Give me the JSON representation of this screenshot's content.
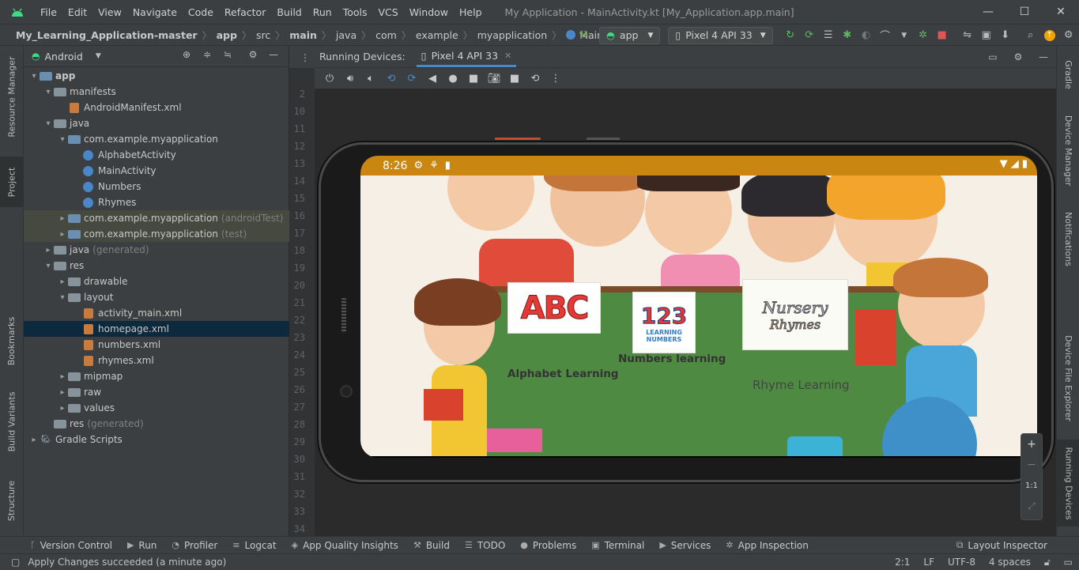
{
  "menubar": {
    "items": [
      "File",
      "Edit",
      "View",
      "Navigate",
      "Code",
      "Refactor",
      "Build",
      "Run",
      "Tools",
      "VCS",
      "Window",
      "Help"
    ],
    "window_title": "My Application - MainActivity.kt [My_Application.app.main]"
  },
  "breadcrumb": [
    "My_Learning_Application-master",
    "app",
    "src",
    "main",
    "java",
    "com",
    "example",
    "myapplication",
    "MainActivity"
  ],
  "toolbar": {
    "run_config": "app",
    "device": "Pixel 4 API 33"
  },
  "left_strip": {
    "tabs": [
      "Resource Manager",
      "Project",
      "Bookmarks",
      "Build Variants",
      "Structure"
    ]
  },
  "project_panel": {
    "view_mode": "Android",
    "tree": [
      {
        "label": "app",
        "depth": 0,
        "expanded": true,
        "icon": "module",
        "bold": true
      },
      {
        "label": "manifests",
        "depth": 1,
        "expanded": true,
        "icon": "folder"
      },
      {
        "label": "AndroidManifest.xml",
        "depth": 2,
        "icon": "manifest"
      },
      {
        "label": "java",
        "depth": 1,
        "expanded": true,
        "icon": "folder"
      },
      {
        "label": "com.example.myapplication",
        "depth": 2,
        "expanded": true,
        "icon": "package"
      },
      {
        "label": "AlphabetActivity",
        "depth": 3,
        "icon": "kotlin"
      },
      {
        "label": "MainActivity",
        "depth": 3,
        "icon": "kotlin"
      },
      {
        "label": "Numbers",
        "depth": 3,
        "icon": "kotlin"
      },
      {
        "label": "Rhymes",
        "depth": 3,
        "icon": "kotlin"
      },
      {
        "label": "com.example.myapplication",
        "suffix": "(androidTest)",
        "depth": 2,
        "collapsed": true,
        "icon": "package",
        "tinted": true
      },
      {
        "label": "com.example.myapplication",
        "suffix": "(test)",
        "depth": 2,
        "collapsed": true,
        "icon": "package",
        "tinted": true
      },
      {
        "label": "java",
        "suffix": "(generated)",
        "depth": 1,
        "collapsed": true,
        "icon": "folder"
      },
      {
        "label": "res",
        "depth": 1,
        "expanded": true,
        "icon": "folder"
      },
      {
        "label": "drawable",
        "depth": 2,
        "collapsed": true,
        "icon": "folder"
      },
      {
        "label": "layout",
        "depth": 2,
        "expanded": true,
        "icon": "folder"
      },
      {
        "label": "activity_main.xml",
        "depth": 3,
        "icon": "xml"
      },
      {
        "label": "homepage.xml",
        "depth": 3,
        "icon": "xml",
        "selected": true
      },
      {
        "label": "numbers.xml",
        "depth": 3,
        "icon": "xml"
      },
      {
        "label": "rhymes.xml",
        "depth": 3,
        "icon": "xml"
      },
      {
        "label": "mipmap",
        "depth": 2,
        "collapsed": true,
        "icon": "folder"
      },
      {
        "label": "raw",
        "depth": 2,
        "collapsed": true,
        "icon": "folder"
      },
      {
        "label": "values",
        "depth": 2,
        "collapsed": true,
        "icon": "folder"
      },
      {
        "label": "res",
        "suffix": "(generated)",
        "depth": 1,
        "icon": "folder"
      },
      {
        "label": "Gradle Scripts",
        "depth": 0,
        "collapsed": true,
        "icon": "gradle"
      }
    ]
  },
  "gutter": {
    "line_numbers": [
      "2",
      "10",
      "11",
      "12",
      "13",
      "14",
      "15",
      "16",
      "17",
      "18",
      "19",
      "20",
      "21",
      "22",
      "23",
      "24",
      "25",
      "26",
      "27",
      "28",
      "29",
      "30",
      "31",
      "32",
      "33",
      "34"
    ]
  },
  "running_devices": {
    "title": "Running Devices:",
    "tab": "Pixel 4 API 33"
  },
  "device_screen": {
    "status_time": "8:26",
    "cards": [
      {
        "name": "Alphabet Learning",
        "label": "Alphabet Learning",
        "image_text": "ABC"
      },
      {
        "name": "Numbers learning",
        "label": "Numbers learning",
        "image_text_top": "123",
        "image_text_bottom": "LEARNING NUMBERS"
      },
      {
        "name": "Rhyme Learning",
        "label": "Rhyme Learning",
        "image_text_top": "Nursery",
        "image_text_bottom": "Rhymes"
      }
    ]
  },
  "zoom": {
    "plus": "+",
    "minus": "−",
    "one_to_one": "1:1"
  },
  "right_strip": {
    "tabs": [
      "Gradle",
      "Device Manager",
      "Notifications",
      "Device File Explorer",
      "Running Devices"
    ]
  },
  "bottom_tools": [
    "Version Control",
    "Run",
    "Profiler",
    "Logcat",
    "App Quality Insights",
    "Build",
    "TODO",
    "Problems",
    "Terminal",
    "Services",
    "App Inspection"
  ],
  "bottom_tools_right": "Layout Inspector",
  "status": {
    "message": "Apply Changes succeeded (a minute ago)",
    "position": "2:1",
    "line_sep": "LF",
    "encoding": "UTF-8",
    "indent": "4 spaces"
  },
  "colors": {
    "status_bar": "#c98712",
    "board_green": "#4f8a43",
    "selection": "#0d293e"
  }
}
